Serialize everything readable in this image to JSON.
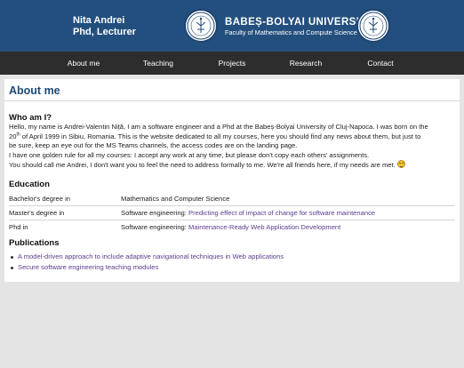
{
  "header": {
    "name": "Nita Andrei",
    "role": "Phd, Lecturer",
    "university": "BABEȘ-BOLYAI UNIVERSITY",
    "faculty": "Faculty of Mathematics and Compute Science",
    "seal_icon": "university-seal-icon",
    "colors": {
      "header_bg": "#234f7e",
      "nav_bg": "#2d2d2d",
      "title": "#1d4a7a",
      "link": "#5b3d8c"
    }
  },
  "nav": {
    "items": [
      {
        "label": "About me"
      },
      {
        "label": "Teaching"
      },
      {
        "label": "Projects"
      },
      {
        "label": "Research"
      },
      {
        "label": "Contact"
      }
    ]
  },
  "main": {
    "title": "About me",
    "who": {
      "heading": "Who am I?",
      "line1_pre": "Hello, my name is Andrei-Valentin Niță, I am a software engineer and a Phd at the Babeș-Bolyai University of Cluj-Napoca. I was born on the",
      "line2_day": "20",
      "line2_sup": "th",
      "line2_rest": " of April 1999 in Sibiu, Romania. This is the website dedicated to all my courses, here you should find any news about them, but just to",
      "line3": "be sure, keep an eye out for the MS Teams channels, the access codes are on the landing page.",
      "line4": "I have one golden rule for all my courses: I accept any work at any time, but please don't copy each others' assignments.",
      "line5": "You should call me Andrei, I don't want you to feel the need to address formally to me. We're all friends here, if my needs are met."
    },
    "education": {
      "heading": "Education",
      "rows": [
        {
          "degree": "Bachelor's degree in",
          "field": "Mathematics and Computer Science",
          "link": ""
        },
        {
          "degree": "Master's degree in",
          "field": "Software engineering:",
          "link": "Predicting effect of impact of change for software maintenance"
        },
        {
          "degree": "Phd in",
          "field": "Software engineering:",
          "link": "Maintenance-Ready Web Application Development"
        }
      ]
    },
    "publications": {
      "heading": "Publications",
      "items": [
        "A model-driven approach to include adaptive navigational techniques in Web applications",
        "Secure software engineering teaching modules"
      ]
    }
  }
}
